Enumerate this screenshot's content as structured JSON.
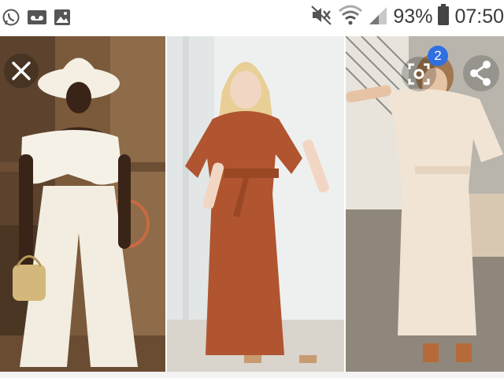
{
  "status_bar": {
    "left_icons": [
      "whatsapp-icon",
      "voicemail-icon",
      "gallery-icon"
    ],
    "right_icons": [
      "mute-icon",
      "wifi-icon",
      "signal-icon",
      "battery-icon"
    ],
    "battery_percent": "93%",
    "time": "07:50"
  },
  "viewer": {
    "close_icon": "close-icon",
    "lens_icon": "lens-search-icon",
    "share_icon": "share-icon",
    "badge_count": "2"
  },
  "photos": [
    {
      "dominant_color": "#f5f1e6",
      "accent": "#8a6a4a"
    },
    {
      "dominant_color": "#b0552f",
      "accent": "#eef0f0"
    },
    {
      "dominant_color": "#f1e4d4",
      "accent": "#b4aea4"
    }
  ],
  "colors": {
    "badge_blue": "#2f6fe0",
    "status_text": "#3a3a3a"
  }
}
